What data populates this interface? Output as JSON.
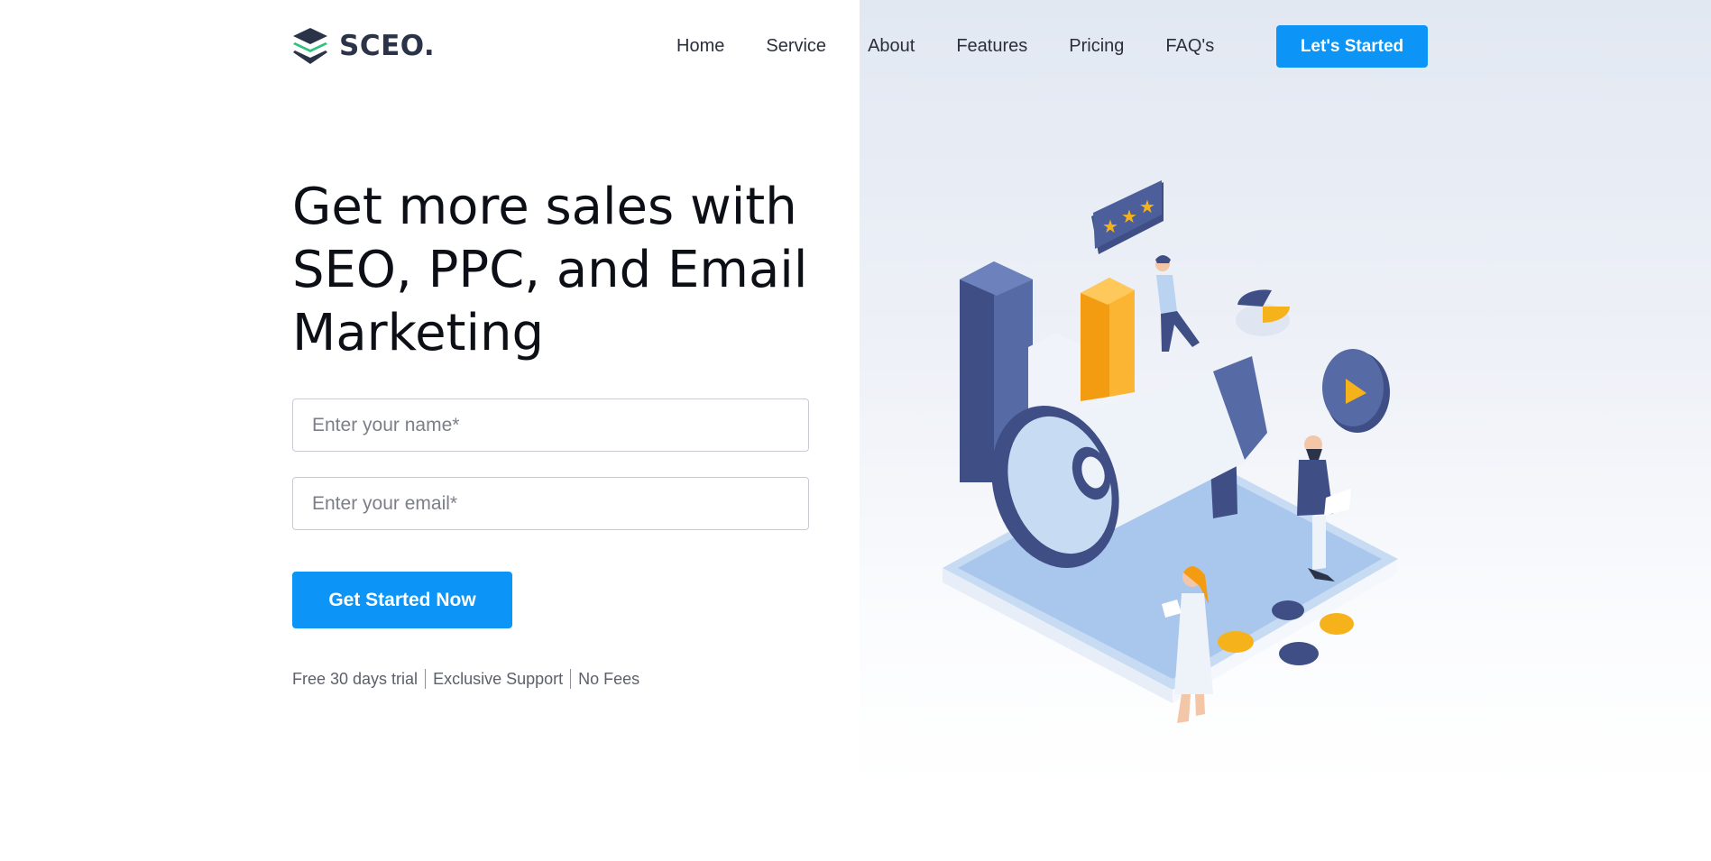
{
  "brand": {
    "name": "SCEO.",
    "accent": "#0c95f7",
    "logo_green": "#2ec27e",
    "logo_dark": "#2b3348"
  },
  "nav": {
    "items": [
      "Home",
      "Service",
      "About",
      "Features",
      "Pricing",
      "FAQ's"
    ],
    "cta_label": "Let's Started"
  },
  "hero": {
    "title_lines": [
      "Get more sales with",
      "SEO, PPC, and Email",
      "Marketing"
    ],
    "name_placeholder": "Enter your name*",
    "email_placeholder": "Enter your email*",
    "submit_label": "Get Started Now",
    "perks": [
      "Free 30 days trial",
      "Exclusive Support",
      "No Fees"
    ]
  },
  "illustration": {
    "icon": "marketing-megaphone-illustration",
    "rating_stars": 3
  }
}
